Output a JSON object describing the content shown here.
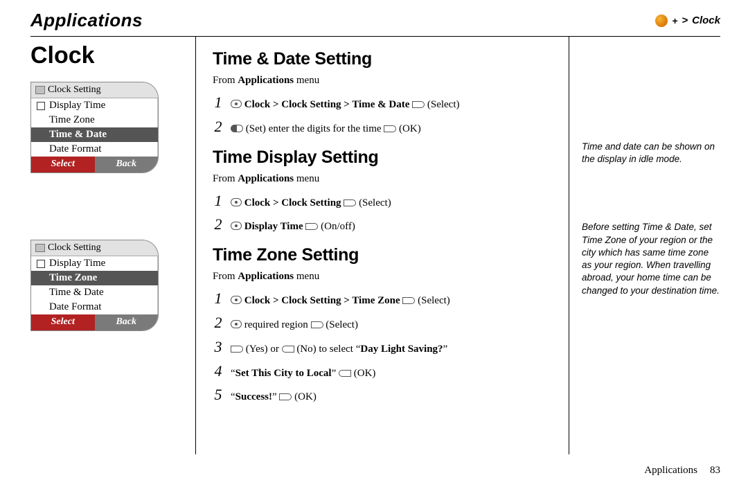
{
  "header": {
    "section_title": "Applications",
    "breadcrumb_arrow": ">",
    "breadcrumb_label": "Clock"
  },
  "page": {
    "title": "Clock"
  },
  "phone1": {
    "title": "Clock Setting",
    "row1": "Display Time",
    "row2": "Time Zone",
    "row_sel": "Time & Date",
    "row4": "Date Format",
    "sk_left": "Select",
    "sk_right": "Back"
  },
  "phone2": {
    "title": "Clock Setting",
    "row1": "Display Time",
    "row_sel": "Time Zone",
    "row3": "Time & Date",
    "row4": "Date Format",
    "sk_left": "Select",
    "sk_right": "Back"
  },
  "sect1": {
    "heading": "Time & Date Setting",
    "from_pre": "From ",
    "from_bold": "Applications",
    "from_post": " menu",
    "s1_bold": "Clock > Clock Setting > Time & Date",
    "s1_tail": " (Select)",
    "s2_pre": " (Set) enter the digits for the time ",
    "s2_tail": " (OK)"
  },
  "sect2": {
    "heading": "Time Display Setting",
    "from_pre": "From ",
    "from_bold": "Applications",
    "from_post": " menu",
    "s1_bold": "Clock > Clock Setting",
    "s1_tail": " (Select)",
    "s2_bold": "Display Time",
    "s2_tail": " (On/off)"
  },
  "sect3": {
    "heading": "Time Zone Setting",
    "from_pre": "From ",
    "from_bold": "Applications",
    "from_post": " menu",
    "s1_bold": "Clock > Clock Setting > Time Zone",
    "s1_tail": " (Select)",
    "s2_mid": " required region ",
    "s2_tail": " (Select)",
    "s3_pre": " (Yes) or ",
    "s3_mid": " (No)  to select “",
    "s3_bold": "Day Light Saving?",
    "s3_post": "”",
    "s4_q1": "“",
    "s4_bold": "Set This City to Local",
    "s4_q2": "” ",
    "s4_tail": " (OK)",
    "s5_q1": "“",
    "s5_bold": "Success!",
    "s5_q2": "” ",
    "s5_tail": " (OK)"
  },
  "notes": {
    "n1": "Time and date can be shown on the display in idle mode.",
    "n2": "Before setting Time & Date, set Time Zone of your region or the city which has same time zone as your region. When travelling abroad, your home time can be changed to your destination time."
  },
  "footer": {
    "label": "Applications",
    "page": "83"
  },
  "nums": {
    "n1": "1",
    "n2": "2",
    "n3": "3",
    "n4": "4",
    "n5": "5"
  }
}
